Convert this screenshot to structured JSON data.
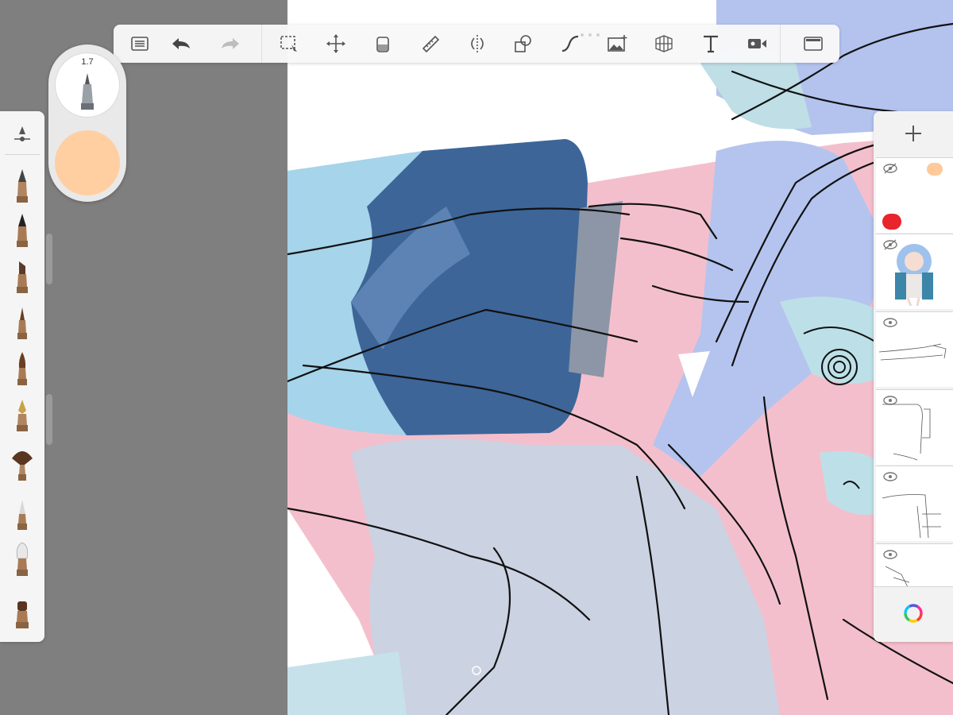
{
  "brush": {
    "size": "1.7",
    "color": "#ffcfa2"
  },
  "toolbar": {
    "tools": [
      "layer-list-icon",
      "undo-icon",
      "redo-icon",
      "selection-icon",
      "transform-icon",
      "fill-icon",
      "ruler-icon",
      "symmetry-icon",
      "shapes-icon",
      "curve-icon",
      "insert-image-icon",
      "perspective-icon",
      "text-icon",
      "time-lapse-icon",
      "full-screen-icon"
    ]
  },
  "brushes": [
    "pencil",
    "pencil-dark",
    "marker",
    "fineliner",
    "paint-brush",
    "fountain-pen",
    "fan-brush",
    "airbrush",
    "soft-brush",
    "smudge"
  ],
  "layers": [
    {
      "id": "layer-colors",
      "visible": false
    },
    {
      "id": "layer-reference",
      "visible": false
    },
    {
      "id": "layer-sketch-arm",
      "visible": true
    },
    {
      "id": "layer-sketch-sleeve",
      "visible": true
    },
    {
      "id": "layer-sketch-body",
      "visible": true
    },
    {
      "id": "layer-sketch-base",
      "visible": true
    }
  ],
  "colors": {
    "accent": "#ffcfa2",
    "canvas": "#ffffff",
    "background": "#7f7f7f"
  }
}
